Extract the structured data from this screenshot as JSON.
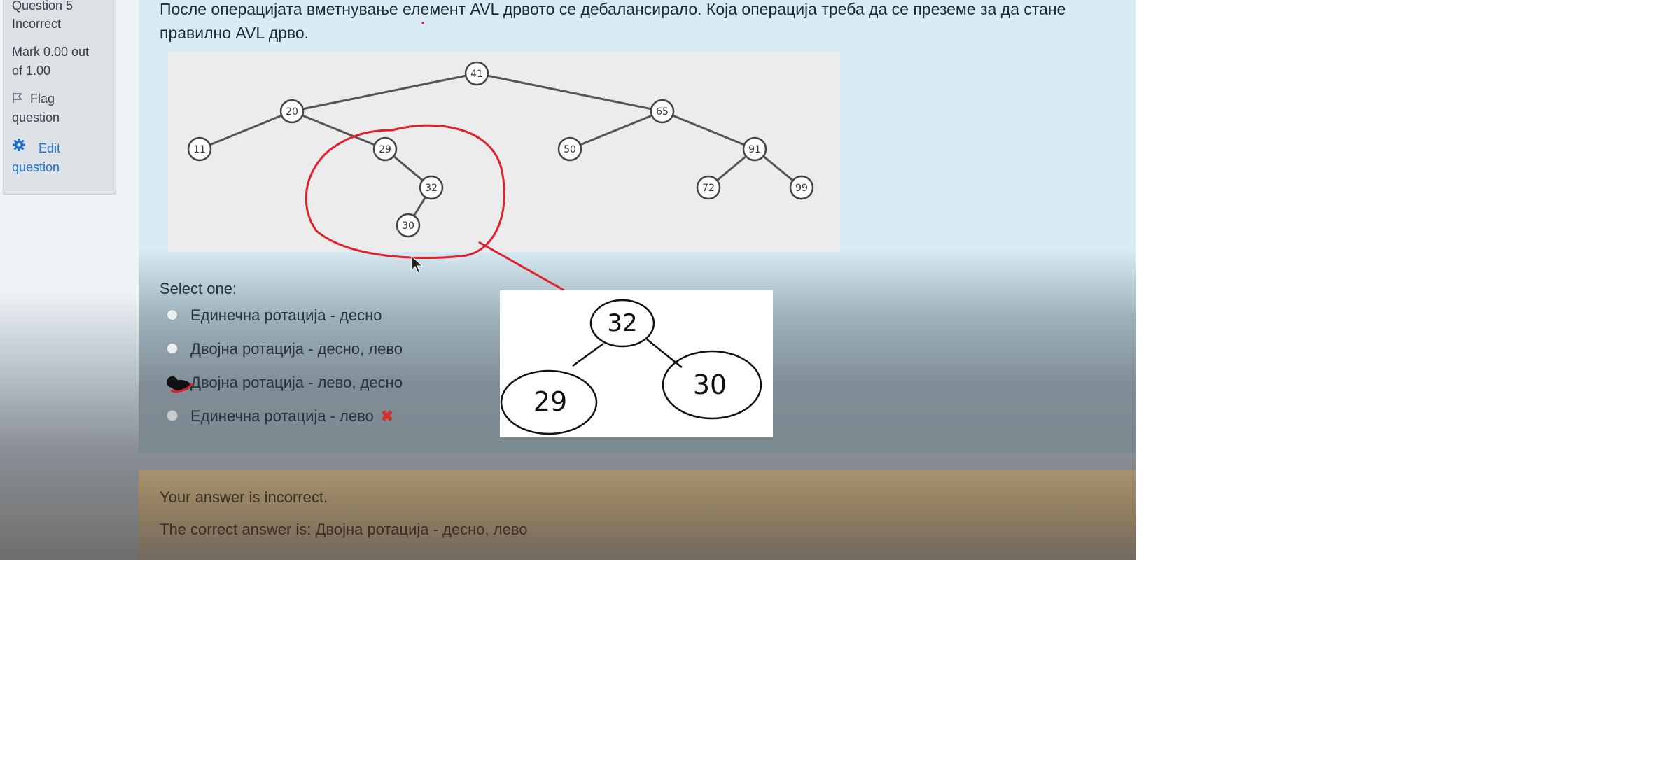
{
  "info": {
    "question": "Question 5",
    "status": "Incorrect",
    "mark_line1": "Mark 0.00 out",
    "mark_line2": "of 1.00",
    "flag_line1": "Flag",
    "flag_line2": "question",
    "edit_line1": "Edit",
    "edit_line2": "question",
    "accent": "#1f6fd1"
  },
  "question": {
    "text": "После операцијата вметнување елемент AVL дрвото се дебалансирало. Која операција треба да се преземе за да стане правилно AVL дрво.",
    "tree_nodes": [
      "41",
      "20",
      "65",
      "11",
      "29",
      "50",
      "91",
      "32",
      "72",
      "99",
      "30"
    ]
  },
  "answers": {
    "select_label": "Select one:",
    "options": [
      {
        "label": "Единечна ротација - десно"
      },
      {
        "label": "Двојна ротација - десно, лево"
      },
      {
        "label": "Двојна ротација - лево, десно"
      },
      {
        "label": "Единечна ротација - лево"
      }
    ],
    "incorrect_mark": "✖",
    "incorrect_color": "#d0312d"
  },
  "feedback": {
    "line1": "Your answer is incorrect.",
    "line2": "The correct answer is: Двојна ротација - десно, лево"
  },
  "note": {
    "nodes": [
      "32",
      "29",
      "30"
    ]
  },
  "annotation_color": "#e0202a"
}
